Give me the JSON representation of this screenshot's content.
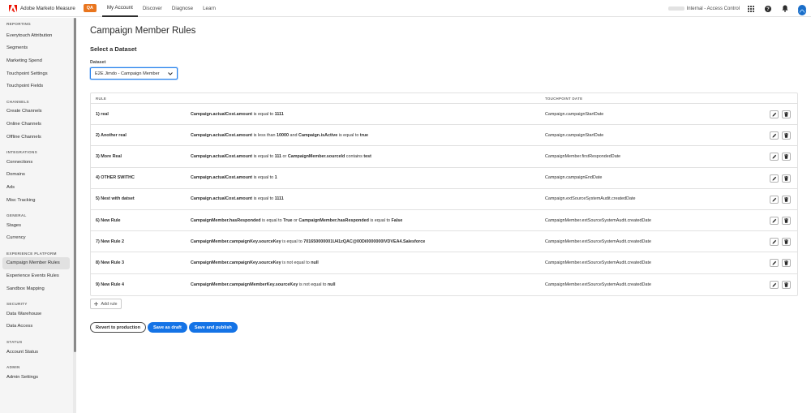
{
  "topbar": {
    "product": "Adobe Marketo Measure",
    "env_badge": "QA",
    "tabs": [
      {
        "label": "My Account",
        "active": true
      },
      {
        "label": "Discover",
        "active": false
      },
      {
        "label": "Diagnose",
        "active": false
      },
      {
        "label": "Learn",
        "active": false
      }
    ],
    "org_suffix": "Internal - Access Control",
    "icons": [
      "apps-grid-icon",
      "help-icon",
      "bell-icon",
      "avatar"
    ]
  },
  "sidebar": {
    "sections": [
      {
        "title": "REPORTING",
        "items": [
          "Everytouch Attribution",
          "Segments",
          "Marketing Spend",
          "Touchpoint Settings",
          "Touchpoint Fields"
        ]
      },
      {
        "title": "CHANNELS",
        "items": [
          "Create Channels",
          "Online Channels",
          "Offline Channels"
        ]
      },
      {
        "title": "INTEGRATIONS",
        "items": [
          "Connections",
          "Domains",
          "Ads",
          "Misc Tracking"
        ]
      },
      {
        "title": "GENERAL",
        "items": [
          "Stages",
          "Currency"
        ]
      },
      {
        "title": "EXPERIENCE PLATFORM",
        "items": [
          "Campaign Member Rules",
          "Experience Events Rules",
          "Sandbox Mapping"
        ]
      },
      {
        "title": "SECURITY",
        "items": [
          "Data Warehouse",
          "Data Access"
        ]
      },
      {
        "title": "STATUS",
        "items": [
          "Account Status"
        ]
      },
      {
        "title": "ADMIN",
        "items": [
          "Admin Settings"
        ]
      }
    ],
    "active_item": "Campaign Member Rules"
  },
  "main": {
    "title": "Campaign Member Rules",
    "subheading": "Select a Dataset",
    "dataset_label": "Dataset",
    "dataset_value": "E2E Jimdo - Campaign Member",
    "table": {
      "headers": {
        "rule": "RULE",
        "touchpoint_date": "TOUCHPOINT DATE"
      },
      "rows": [
        {
          "name": "1) real",
          "cond": [
            [
              "b",
              "Campaign.actualCost.amount"
            ],
            [
              "t",
              " is equal to "
            ],
            [
              "b",
              "1111"
            ]
          ],
          "date": "Campaign.campaignStartDate"
        },
        {
          "name": "2) Another real",
          "cond": [
            [
              "b",
              "Campaign.actualCost.amount"
            ],
            [
              "t",
              " is less than "
            ],
            [
              "b",
              "10000"
            ],
            [
              "t",
              " and "
            ],
            [
              "b",
              "Campaign.isActive"
            ],
            [
              "t",
              " is equal to "
            ],
            [
              "b",
              "true"
            ]
          ],
          "date": "Campaign.campaignStartDate"
        },
        {
          "name": "3) More Real",
          "cond": [
            [
              "b",
              "Campaign.actualCost.amount"
            ],
            [
              "t",
              " is equal to "
            ],
            [
              "b",
              "111"
            ],
            [
              "t",
              " or "
            ],
            [
              "b",
              "CampaignMember.sourceId"
            ],
            [
              "t",
              " contains "
            ],
            [
              "b",
              "test"
            ]
          ],
          "date": "CampaignMember.firstRespondedDate"
        },
        {
          "name": "4) OTHER SWITHC",
          "cond": [
            [
              "b",
              "Campaign.actualCost.amount"
            ],
            [
              "t",
              " is equal to "
            ],
            [
              "b",
              "1"
            ]
          ],
          "date": "Campaign.campaignEndDate"
        },
        {
          "name": "5) Nest with datset",
          "cond": [
            [
              "b",
              "Campaign.actualCost.amount"
            ],
            [
              "t",
              " is equal to "
            ],
            [
              "b",
              "1111"
            ]
          ],
          "date": "Campaign.extSourceSystemAudit.createdDate"
        },
        {
          "name": "6) New Rule",
          "cond": [
            [
              "b",
              "CampaignMember.hasResponded"
            ],
            [
              "t",
              " is equal to "
            ],
            [
              "b",
              "True"
            ],
            [
              "t",
              " or "
            ],
            [
              "b",
              "CampaignMember.hasResponded"
            ],
            [
              "t",
              " is equal to "
            ],
            [
              "b",
              "False"
            ]
          ],
          "date": "CampaignMember.extSourceSystemAudit.createdDate"
        },
        {
          "name": "7) New Rule 2",
          "cond": [
            [
              "b",
              "CampaignMember.campaignKey.sourceKey"
            ],
            [
              "t",
              " is equal to "
            ],
            [
              "b",
              "701650000001U41zQAC@00Di0000000IVDVEA4.Salesforce"
            ]
          ],
          "date": "CampaignMember.extSourceSystemAudit.createdDate"
        },
        {
          "name": "8) New Rule 3",
          "cond": [
            [
              "b",
              "CampaignMember.campaignKey.sourceKey"
            ],
            [
              "t",
              " is not equal to "
            ],
            [
              "b",
              "null"
            ]
          ],
          "date": "CampaignMember.extSourceSystemAudit.createdDate"
        },
        {
          "name": "9) New Rule 4",
          "cond": [
            [
              "b",
              "CampaignMember.campaignMemberKey.sourceKey"
            ],
            [
              "t",
              " is not equal to "
            ],
            [
              "b",
              "null"
            ]
          ],
          "date": "CampaignMember.extSourceSystemAudit.createdDate"
        }
      ]
    },
    "add_rule_label": "Add rule",
    "buttons": {
      "revert": "Revert to production",
      "draft": "Save as draft",
      "publish": "Save and publish"
    }
  }
}
